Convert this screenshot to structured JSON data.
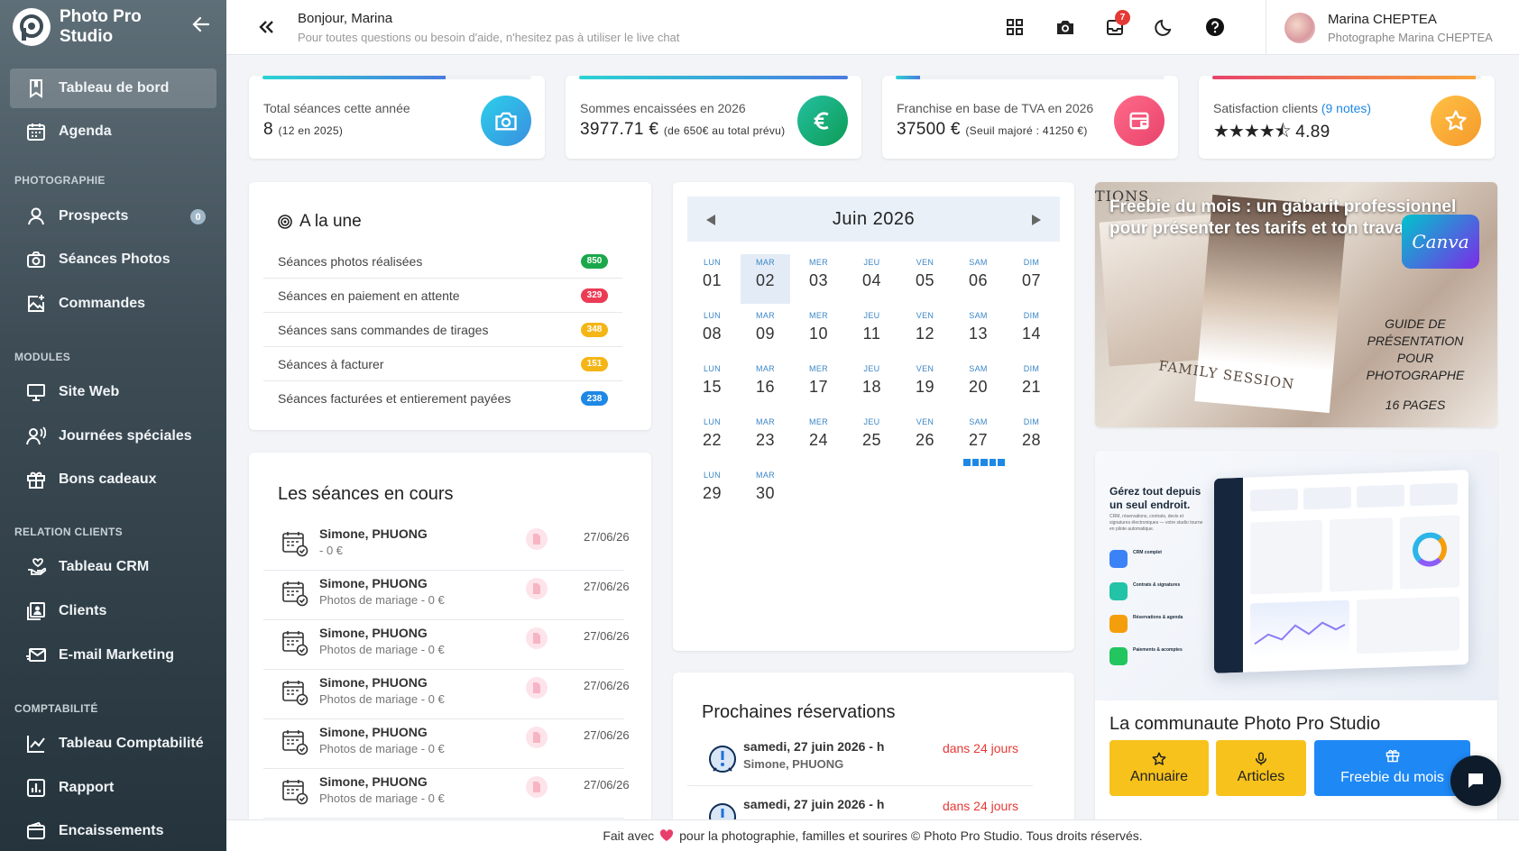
{
  "brand": {
    "name": "Photo Pro Studio"
  },
  "sidebar": {
    "items": [
      {
        "label": "Tableau de bord",
        "icon": "bookmark-icon",
        "active": true
      },
      {
        "label": "Agenda",
        "icon": "calendar-icon"
      },
      {
        "label": "Prospects",
        "icon": "person-icon",
        "badge": "0"
      },
      {
        "label": "Séances Photos",
        "icon": "camera-icon"
      },
      {
        "label": "Commandes",
        "icon": "image-add-icon"
      },
      {
        "label": "Site Web",
        "icon": "monitor-icon"
      },
      {
        "label": "Journées spéciales",
        "icon": "users-voice-icon"
      },
      {
        "label": "Bons cadeaux",
        "icon": "gift-icon"
      },
      {
        "label": "Tableau CRM",
        "icon": "hand-heart-icon"
      },
      {
        "label": "Clients",
        "icon": "contacts-icon"
      },
      {
        "label": "E-mail Marketing",
        "icon": "mail-send-icon"
      },
      {
        "label": "Tableau Comptabilité",
        "icon": "chart-line-icon"
      },
      {
        "label": "Rapport",
        "icon": "report-icon"
      },
      {
        "label": "Encaissements",
        "icon": "wallet-icon"
      }
    ],
    "sections": [
      "PHOTOGRAPHIE",
      "MODULES",
      "RELATION CLIENTS",
      "COMPTABILITÉ"
    ]
  },
  "header": {
    "greeting": "Bonjour, Marina",
    "subtitle": "Pour toutes questions ou besoin d'aide, n'hesitez pas à utiliser le live chat",
    "notifications": "7",
    "user_name": "Marina CHEPTEA",
    "user_role": "Photographe Marina CHEPTEA"
  },
  "stats": [
    {
      "label": "Total séances cette année",
      "value": "8",
      "note": "(12 en 2025)",
      "progress": 0.68,
      "color": "#2bc4e8"
    },
    {
      "label": "Sommes encaissées en 2026",
      "value": "3977.71 €",
      "note": "(de 650€ au total prévu)",
      "progress": 1.0,
      "color": "#1ab394"
    },
    {
      "label": "Franchise en base de TVA en 2026",
      "value": "37500 €",
      "note": "(Seuil majoré : 41250 €)",
      "progress": 0.09,
      "color": "#2bc4e8"
    },
    {
      "label": "Satisfaction clients",
      "label_extra": "(9 notes)",
      "value": "4.89",
      "stars": "★★★★⯪",
      "progress": 0.98,
      "color": "#e8436b"
    }
  ],
  "une": {
    "title": "A la une",
    "rows": [
      {
        "label": "Séances photos réalisées",
        "count": "850",
        "color": "#1aa84b"
      },
      {
        "label": "Séances en paiement en attente",
        "count": "329",
        "color": "#ec3b55"
      },
      {
        "label": "Séances sans commandes de tirages",
        "count": "348",
        "color": "#f4b617"
      },
      {
        "label": "Séances à facturer",
        "count": "151",
        "color": "#f4b617"
      },
      {
        "label": "Séances facturées et entierement payées",
        "count": "238",
        "color": "#1e88e5"
      }
    ]
  },
  "seances": {
    "title": "Les séances en cours",
    "rows": [
      {
        "name": "Simone, PHUONG",
        "sub": "- 0 €",
        "date": "27/06/26"
      },
      {
        "name": "Simone, PHUONG",
        "sub": "Photos de mariage - 0 €",
        "date": "27/06/26"
      },
      {
        "name": "Simone, PHUONG",
        "sub": "Photos de mariage - 0 €",
        "date": "27/06/26"
      },
      {
        "name": "Simone, PHUONG",
        "sub": "Photos de mariage - 0 €",
        "date": "27/06/26"
      },
      {
        "name": "Simone, PHUONG",
        "sub": "Photos de mariage - 0 €",
        "date": "27/06/26"
      },
      {
        "name": "Simone, PHUONG",
        "sub": "Photos de mariage - 0 €",
        "date": "27/06/26"
      }
    ]
  },
  "calendar": {
    "month": "Juin 2026",
    "weekdays": [
      "LUN",
      "MAR",
      "MER",
      "JEU",
      "VEN",
      "SAM",
      "DIM"
    ],
    "days": [
      "01",
      "02",
      "03",
      "04",
      "05",
      "06",
      "07",
      "08",
      "09",
      "10",
      "11",
      "12",
      "13",
      "14",
      "15",
      "16",
      "17",
      "18",
      "19",
      "20",
      "21",
      "22",
      "23",
      "24",
      "25",
      "26",
      "27",
      "28",
      "29",
      "30"
    ],
    "selected": "02",
    "event_day": "27"
  },
  "reservations": {
    "title": "Prochaines réservations",
    "rows": [
      {
        "date": "samedi, 27 juin 2026 - h",
        "name": "Simone, PHUONG",
        "when": "dans 24 jours"
      },
      {
        "date": "samedi, 27 juin 2026 - h",
        "name": "",
        "when": "dans 24 jours"
      }
    ]
  },
  "promo1": {
    "title": "Freebie du mois : un gabarit professionnel pour présenter tes tarifs et ton travail photo",
    "canva": "Canva",
    "guide": "GUIDE DE PRÉSENTATION POUR PHOTOGRAPHE",
    "pages": "16 PAGES",
    "family": "FAMILY SESSION",
    "tions": "TIONS"
  },
  "promo2": {
    "headline": "Gérez tout depuis un seul endroit.",
    "text": "CRM, réservations, contrats, devis et signatures électroniques — votre studio tourne en pilote automatique.",
    "features": [
      {
        "label": "CRM complet",
        "color": "#3b82f6"
      },
      {
        "label": "Contrats & signatures",
        "color": "#22c3a6"
      },
      {
        "label": "Réservations & agenda",
        "color": "#f59e0b"
      },
      {
        "label": "Paiements & acomptes",
        "color": "#22c55e"
      }
    ],
    "community": "La communaute Photo Pro Studio",
    "buttons": [
      {
        "label": "Annuaire",
        "icon": "star-icon"
      },
      {
        "label": "Articles",
        "icon": "microphone-icon"
      },
      {
        "label": "Freebie du mois",
        "icon": "gift-icon"
      }
    ]
  },
  "footer": {
    "before": "Fait avec",
    "after": "pour la photographie, familles et sourires © Photo Pro Studio. Tous droits réservés."
  }
}
